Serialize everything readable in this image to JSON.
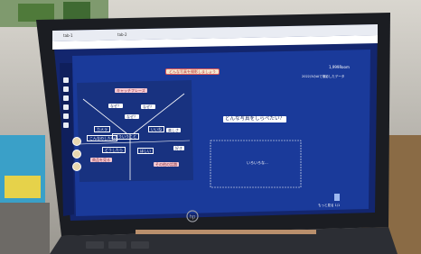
{
  "browser": {
    "tabs": [
      "tab-1",
      "tab-2"
    ],
    "address": ""
  },
  "whiteboard": {
    "top_banner": "どんな写真を撮影しましょう",
    "header_right": "1,999Room",
    "header_title": "2022/3のAIで撮影したデータ",
    "question_box": "どんな写真をしらべたい？",
    "pink_tags": [
      "キャッチフレーズ",
      "商品を見る",
      "その他の話題"
    ],
    "white_notes": [
      "なぜ？",
      "なぜ？",
      "なぜ？",
      "楽しさ",
      "好き"
    ],
    "small_labels": [
      "こんなのしたい",
      "どういうこと",
      "どうしたら",
      "ほしい",
      "カメラ",
      "いいね"
    ],
    "rect_label": "いろいろな...",
    "footer_label": "もっと見る 1/1"
  },
  "laptop": {
    "brand_logo": "hp-logo"
  },
  "colors": {
    "board_blue": "#1a3a9a",
    "board_dark": "#13266e",
    "bezel": "#1b1d22"
  }
}
